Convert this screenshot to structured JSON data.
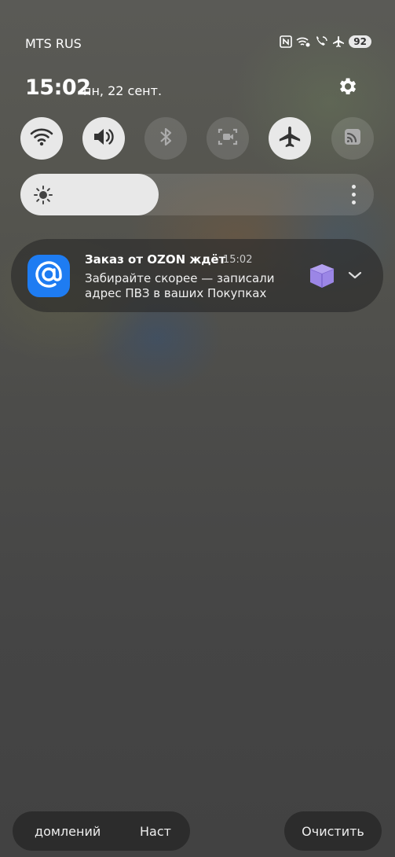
{
  "status_bar": {
    "carrier": "MTS RUS",
    "icons": [
      "nfc-icon",
      "wifi-calling-icon",
      "volte-icon",
      "airplane-mode-icon"
    ],
    "battery": "92"
  },
  "header": {
    "time": "15:02",
    "date": "пн, 22 сент."
  },
  "quick_settings": [
    {
      "name": "wifi",
      "state": "on"
    },
    {
      "name": "sound",
      "state": "on"
    },
    {
      "name": "bluetooth",
      "state": "off"
    },
    {
      "name": "screen-recorder",
      "state": "off"
    },
    {
      "name": "airplane-mode",
      "state": "on"
    },
    {
      "name": "cast",
      "state": "off"
    }
  ],
  "brightness": {
    "level": 0.39
  },
  "notification": {
    "title": "Заказ от OZON ждёт",
    "time": "15:02",
    "body": "Забирайте скорее — записали адрес ПВЗ в ваших Покупках",
    "app_icon": "at-sign-icon"
  },
  "bottom": {
    "left_label_1": "домлений",
    "left_label_2": "Наст",
    "clear_label": "Очистить"
  },
  "colors": {
    "tile_on": "#e8e8e8",
    "app_icon_bg": "#1e7cf2",
    "thumb_purple": "#9b86e6"
  }
}
